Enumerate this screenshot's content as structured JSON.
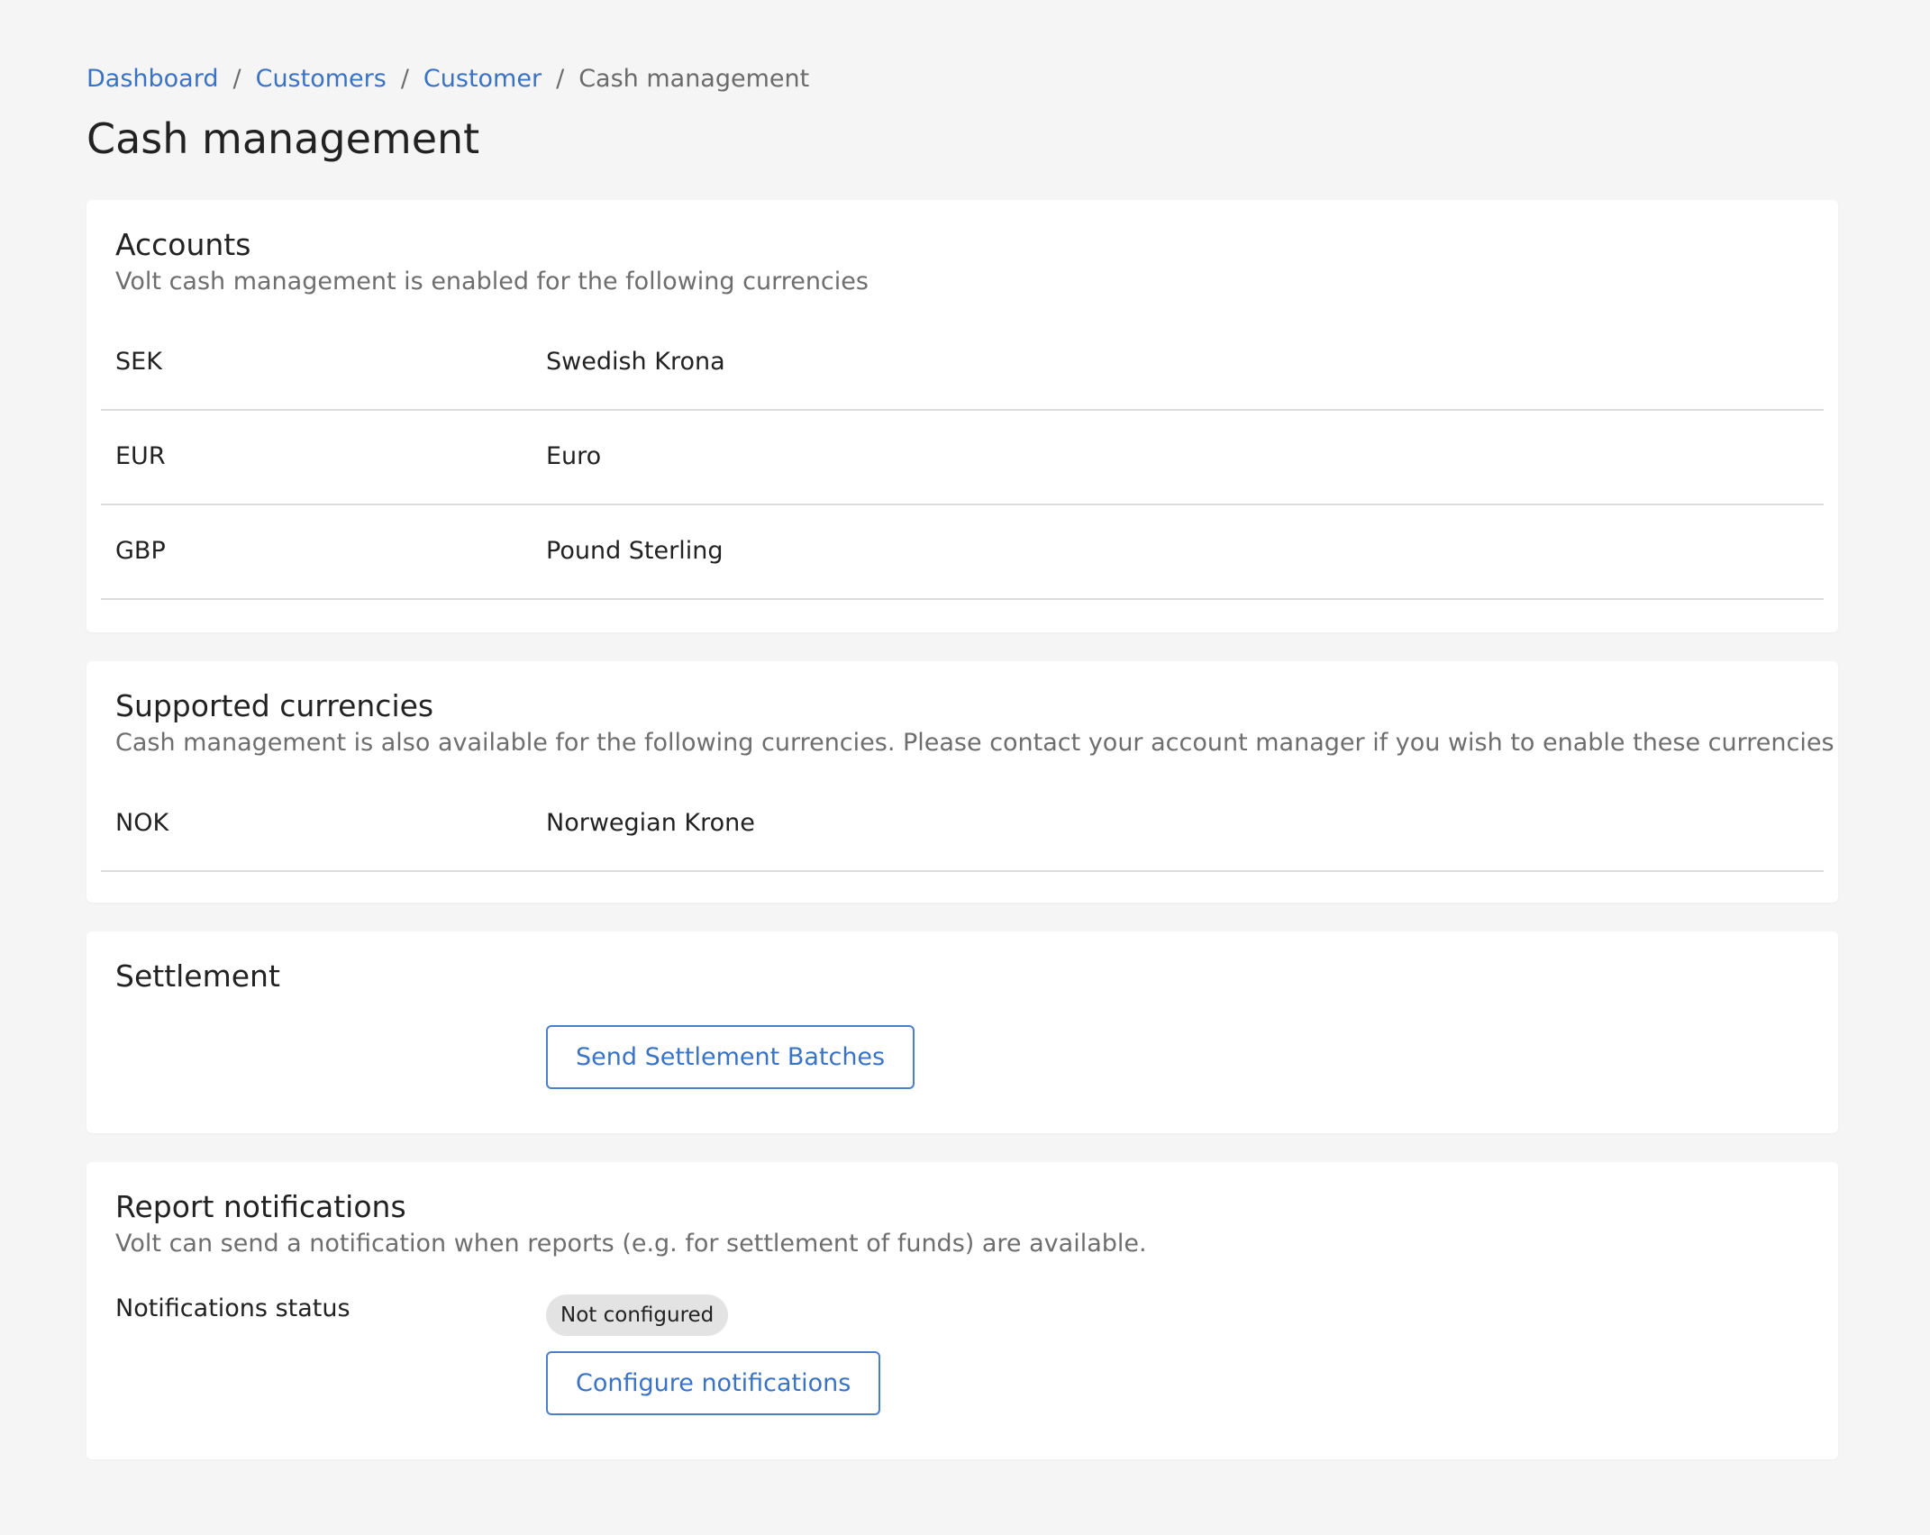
{
  "breadcrumb": {
    "items": [
      {
        "label": "Dashboard"
      },
      {
        "label": "Customers"
      },
      {
        "label": "Customer"
      }
    ],
    "separator": "/",
    "current": "Cash management"
  },
  "page": {
    "title": "Cash management"
  },
  "accounts": {
    "title": "Accounts",
    "subtitle": "Volt cash management is enabled for the following currencies",
    "rows": [
      {
        "code": "SEK",
        "name": "Swedish Krona"
      },
      {
        "code": "EUR",
        "name": "Euro"
      },
      {
        "code": "GBP",
        "name": "Pound Sterling"
      }
    ]
  },
  "supported": {
    "title": "Supported currencies",
    "subtitle": "Cash management is also available for the following currencies. Please contact your account manager if you wish to enable these currencies",
    "rows": [
      {
        "code": "NOK",
        "name": "Norwegian Krone"
      }
    ]
  },
  "settlement": {
    "title": "Settlement",
    "button_label": "Send Settlement Batches"
  },
  "reports": {
    "title": "Report notifications",
    "subtitle": "Volt can send a notification when reports (e.g. for settlement of funds) are available.",
    "status_label": "Notifications status",
    "status_value": "Not configured",
    "button_label": "Configure notifications"
  },
  "colors": {
    "accent": "#3a73c4",
    "background": "#f5f5f5",
    "card": "#ffffff",
    "muted_text": "#6e6e6e",
    "badge_bg": "#e3e3e3"
  }
}
